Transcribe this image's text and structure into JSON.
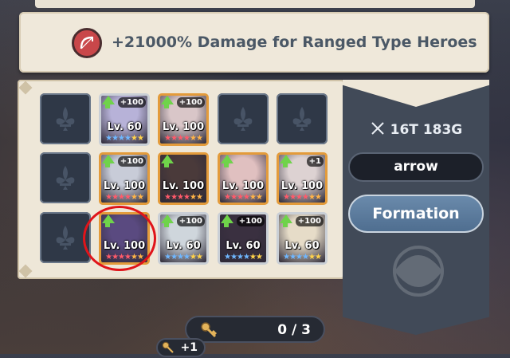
{
  "banner": {
    "text": "+21000% Damage for Ranged Type Heroes",
    "icon": "bow-icon",
    "icon_color": "#c9474a"
  },
  "grid": {
    "rows": [
      [
        {
          "type": "empty"
        },
        {
          "type": "hero",
          "level": "Lv. 60",
          "bonus": "+100",
          "frame": "silver",
          "upgrade": true,
          "stars": "blue",
          "tint": "#b7b2d8"
        },
        {
          "type": "hero",
          "level": "Lv. 100",
          "bonus": "+100",
          "frame": "gold",
          "upgrade": true,
          "stars": "red",
          "tint": "#d9c6c8"
        },
        {
          "type": "empty"
        },
        {
          "type": "empty"
        }
      ],
      [
        {
          "type": "empty"
        },
        {
          "type": "hero",
          "level": "Lv. 100",
          "bonus": "+100",
          "frame": "gold",
          "upgrade": true,
          "stars": "red",
          "tint": "#c8ccd8"
        },
        {
          "type": "hero",
          "level": "Lv. 100",
          "bonus": "",
          "frame": "gold",
          "upgrade": true,
          "stars": "red",
          "tint": "#4a3a3a"
        },
        {
          "type": "hero",
          "level": "Lv. 100",
          "bonus": "",
          "frame": "gold",
          "upgrade": true,
          "stars": "red",
          "tint": "#e0c0c0"
        },
        {
          "type": "hero",
          "level": "Lv. 100",
          "bonus": "+1",
          "frame": "gold",
          "upgrade": true,
          "stars": "red",
          "tint": "#ddd2d2"
        }
      ],
      [
        {
          "type": "empty"
        },
        {
          "type": "hero",
          "level": "Lv. 100",
          "bonus": "",
          "frame": "gold",
          "upgrade": true,
          "stars": "red",
          "tint": "#5a4a80"
        },
        {
          "type": "hero",
          "level": "Lv. 60",
          "bonus": "+100",
          "frame": "silver",
          "upgrade": true,
          "stars": "blue",
          "tint": "#cfd6dc"
        },
        {
          "type": "hero",
          "level": "Lv. 60",
          "bonus": "+100",
          "frame": "silver",
          "upgrade": true,
          "stars": "blue",
          "tint": "#3a3040"
        },
        {
          "type": "hero",
          "level": "Lv. 60",
          "bonus": "+100",
          "frame": "silver",
          "upgrade": true,
          "stars": "blue",
          "tint": "#e6dcc8"
        }
      ]
    ]
  },
  "side": {
    "power": "16T 183G",
    "filter": "arrow",
    "formation": "Formation"
  },
  "counter": {
    "value": "0 / 3",
    "plus": "+1"
  },
  "colors": {
    "gold_frame": "#e39b3b",
    "silver_frame": "#c9cfd6",
    "upgrade_arrow": "#6fd34a",
    "highlight": "#e0141a"
  }
}
